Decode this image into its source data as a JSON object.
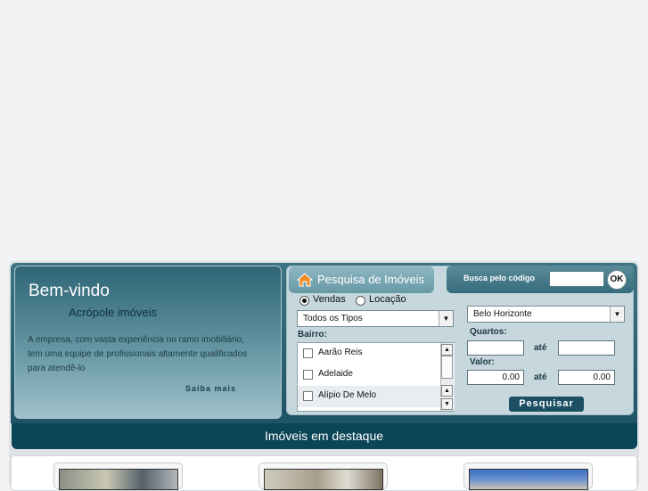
{
  "welcome": {
    "title": "Bem-vindo",
    "company": "Acrópole imóveis",
    "text": "A empresa, com vasta experiência no ramo imobiliário, tem uma equipe de profissionais altamente qualificados para atendê-lo",
    "more_link": "Saiba mais"
  },
  "search": {
    "title": "Pesquisa de Imóveis",
    "icon": "home-icon",
    "mode_options": [
      {
        "label": "Vendas",
        "selected": true
      },
      {
        "label": "Locação",
        "selected": false
      }
    ],
    "type_select": "Todos os Tipos",
    "bairro_label": "Bairro:",
    "bairros": [
      "Aarão Reis",
      "Adelaide",
      "Alípio De Melo"
    ],
    "city_select": "Belo Horizonte",
    "quartos_label": "Quartos:",
    "quartos_from": "",
    "quartos_to": "",
    "valor_label": "Valor:",
    "valor_from": "0.00",
    "valor_to": "0.00",
    "ate_label": "até",
    "submit_label": "Pesquisar"
  },
  "code_search": {
    "label": "Busca pelo código",
    "value": "",
    "ok_label": "OK"
  },
  "destaque": {
    "title": "Imóveis em destaque"
  },
  "colors": {
    "header_dark": "#0b4658",
    "panel_teal": "#3e7384",
    "page_bg": "#f1f2f3"
  }
}
